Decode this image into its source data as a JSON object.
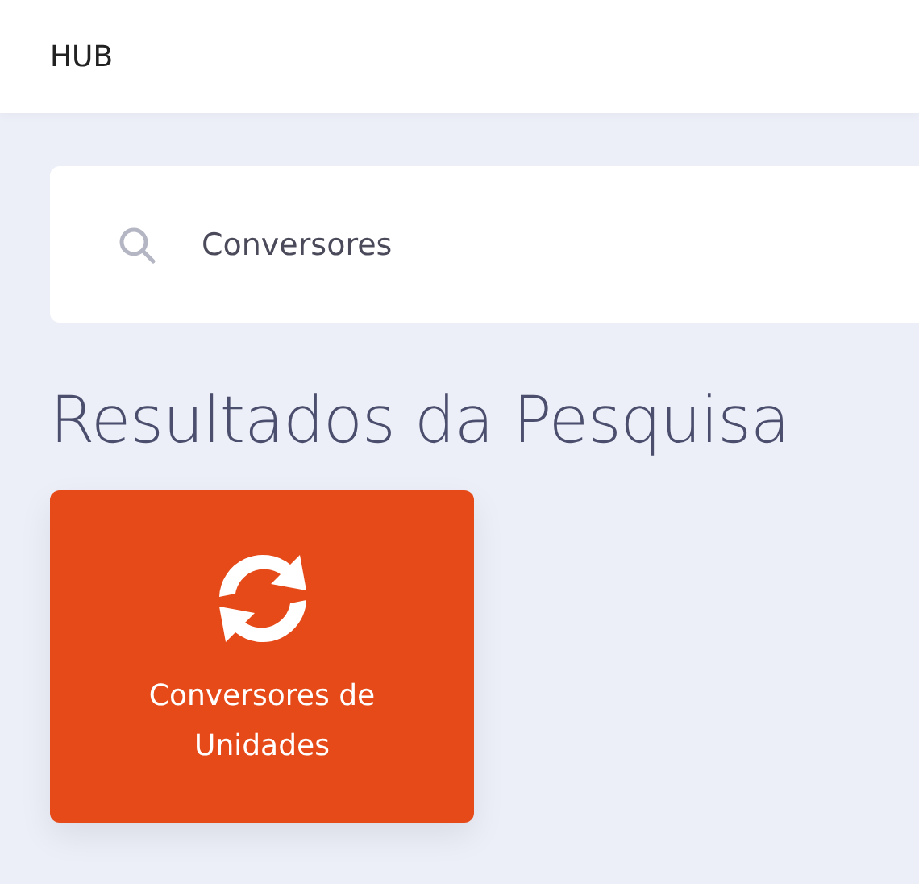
{
  "header": {
    "title": "HUB"
  },
  "search": {
    "value": "Conversores"
  },
  "results": {
    "title": "Resultados da Pesquisa",
    "items": [
      {
        "label": "Conversores de Unidades",
        "kind": "converter"
      }
    ]
  }
}
